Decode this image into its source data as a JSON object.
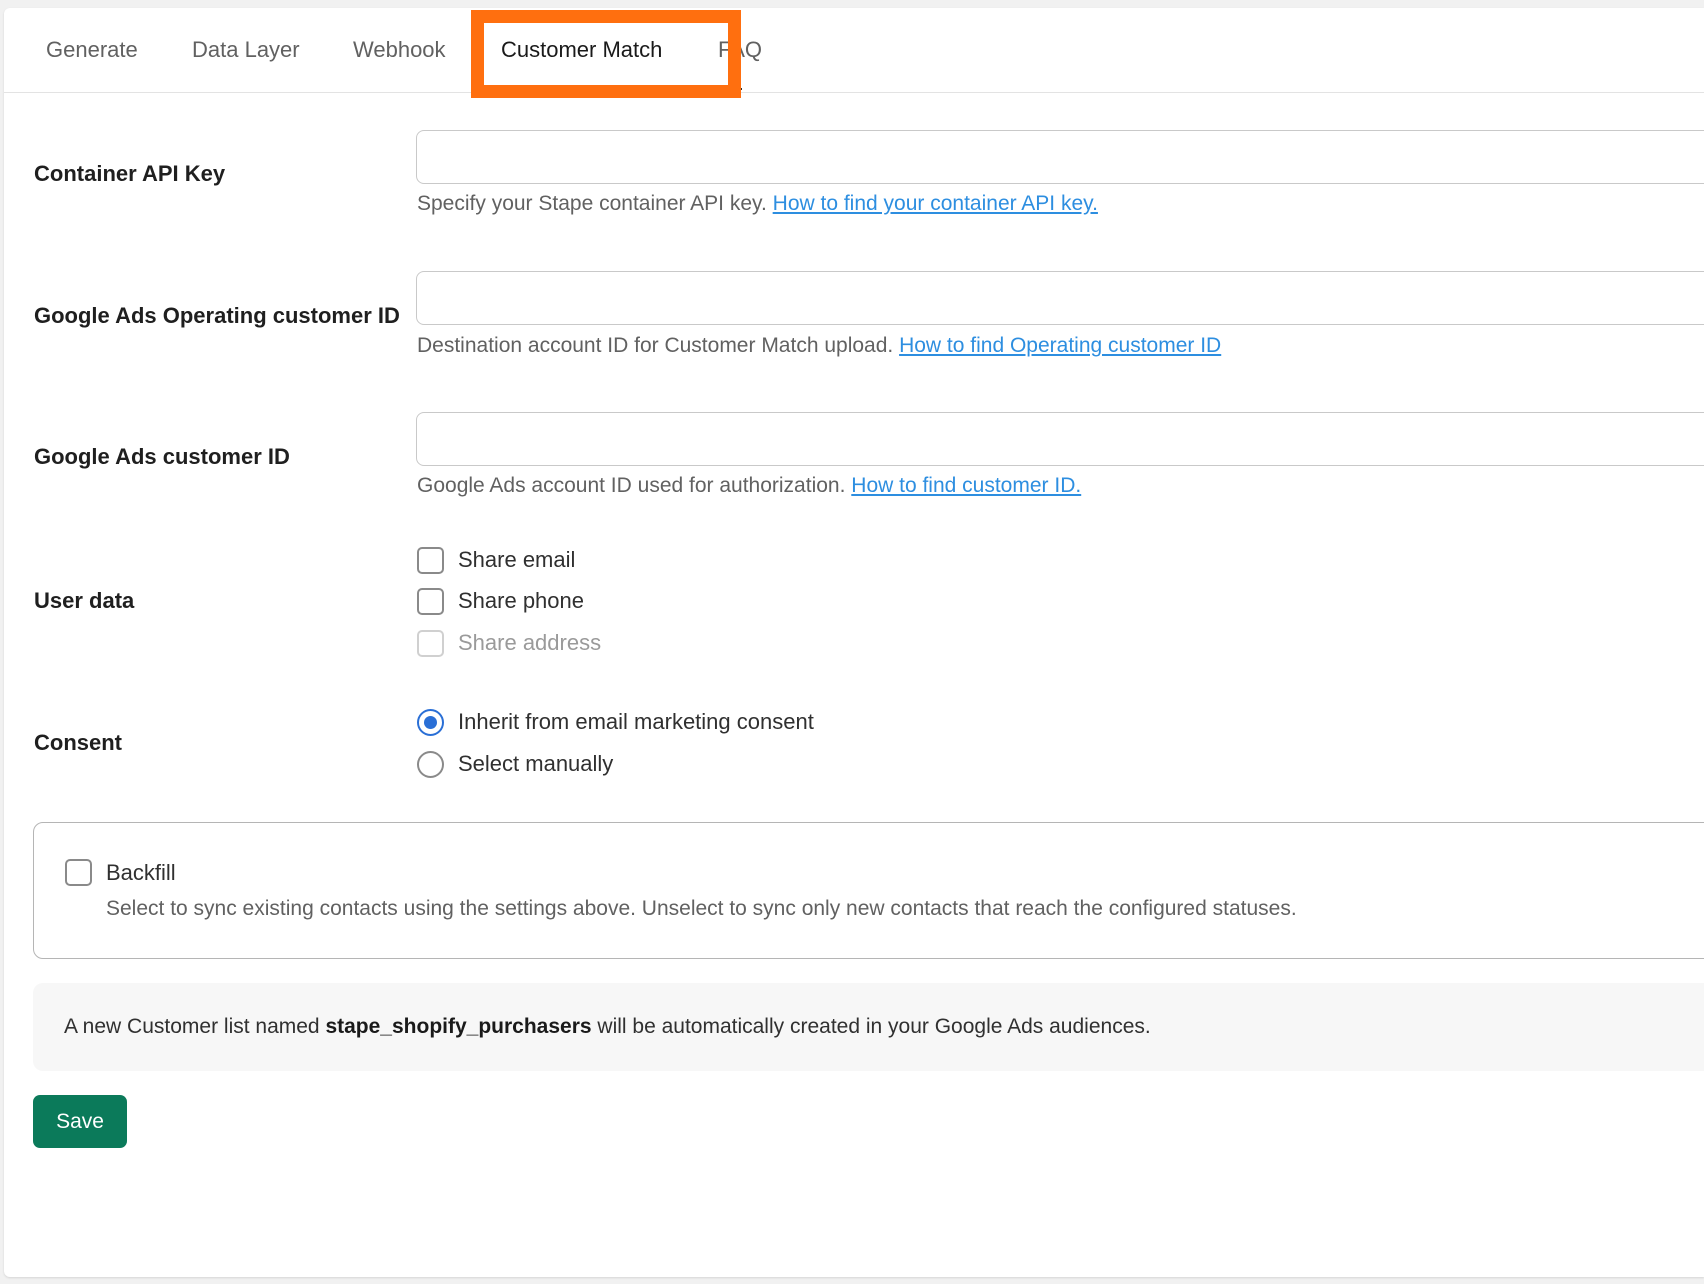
{
  "tabs": [
    {
      "label": "Generate",
      "active": false
    },
    {
      "label": "Data Layer",
      "active": false
    },
    {
      "label": "Webhook",
      "active": false
    },
    {
      "label": "Customer Match",
      "active": true
    },
    {
      "label": "FAQ",
      "active": false
    }
  ],
  "highlight_color": "#ff6f0f",
  "fields": {
    "container_api_key": {
      "label": "Container API Key",
      "value": "",
      "help_text": "Specify your Stape container API key.",
      "help_link": "How to find your container API key."
    },
    "operating_customer_id": {
      "label": "Google Ads Operating customer ID",
      "value": "",
      "help_text": "Destination account ID for Customer Match upload.",
      "help_link": "How to find Operating customer ID"
    },
    "customer_id": {
      "label": "Google Ads customer ID",
      "value": "",
      "help_text": "Google Ads account ID used for authorization.",
      "help_link": "How to find customer ID."
    }
  },
  "user_data": {
    "label": "User data",
    "options": [
      {
        "label": "Share email",
        "checked": false,
        "disabled": false
      },
      {
        "label": "Share phone",
        "checked": false,
        "disabled": false
      },
      {
        "label": "Share address",
        "checked": false,
        "disabled": true
      }
    ]
  },
  "consent": {
    "label": "Consent",
    "options": [
      {
        "label": "Inherit from email marketing consent",
        "selected": true
      },
      {
        "label": "Select manually",
        "selected": false
      }
    ]
  },
  "backfill": {
    "label": "Backfill",
    "checked": false,
    "description": "Select to sync existing contacts using the settings above. Unselect to sync only new contacts that reach the configured statuses."
  },
  "info": {
    "prefix": "A new Customer list named ",
    "list_name": "stape_shopify_purchasers",
    "suffix": " will be automatically created in your Google Ads audiences."
  },
  "save_label": "Save",
  "colors": {
    "accent_blue": "#2a6fd6",
    "link_blue": "#2d8ee0",
    "save_green": "#0b7a5a"
  }
}
